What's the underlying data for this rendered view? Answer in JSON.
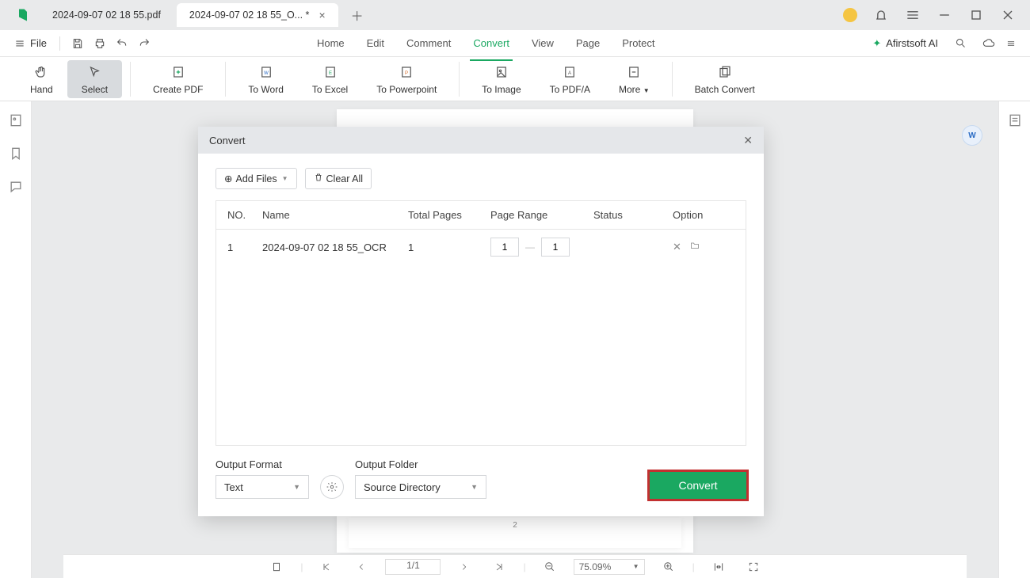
{
  "tabs": {
    "t0": "2024-09-07 02 18 55.pdf",
    "t1": "2024-09-07 02 18 55_O... *"
  },
  "filebar": {
    "file": "File"
  },
  "menu": {
    "home": "Home",
    "edit": "Edit",
    "comment": "Comment",
    "convert": "Convert",
    "view": "View",
    "page": "Page",
    "protect": "Protect",
    "ai": "Afirstsoft AI"
  },
  "ribbon": {
    "hand": "Hand",
    "select": "Select",
    "createpdf": "Create PDF",
    "toword": "To Word",
    "toexcel": "To Excel",
    "toppt": "To Powerpoint",
    "toimage": "To Image",
    "topdfa": "To PDF/A",
    "more": "More",
    "batch": "Batch Convert"
  },
  "dialog": {
    "title": "Convert",
    "addfiles": "Add Files",
    "clearall": "Clear All",
    "th": {
      "no": "NO.",
      "name": "Name",
      "pages": "Total Pages",
      "range": "Page Range",
      "status": "Status",
      "option": "Option"
    },
    "row": {
      "no": "1",
      "name": "2024-09-07 02 18 55_OCR",
      "pages": "1",
      "from": "1",
      "to": "1"
    },
    "outputformat_label": "Output Format",
    "outputformat_value": "Text",
    "outputfolder_label": "Output Folder",
    "outputfolder_value": "Source Directory",
    "convert": "Convert"
  },
  "status": {
    "page": "1/1",
    "zoom": "75.09%"
  },
  "page2": "2"
}
